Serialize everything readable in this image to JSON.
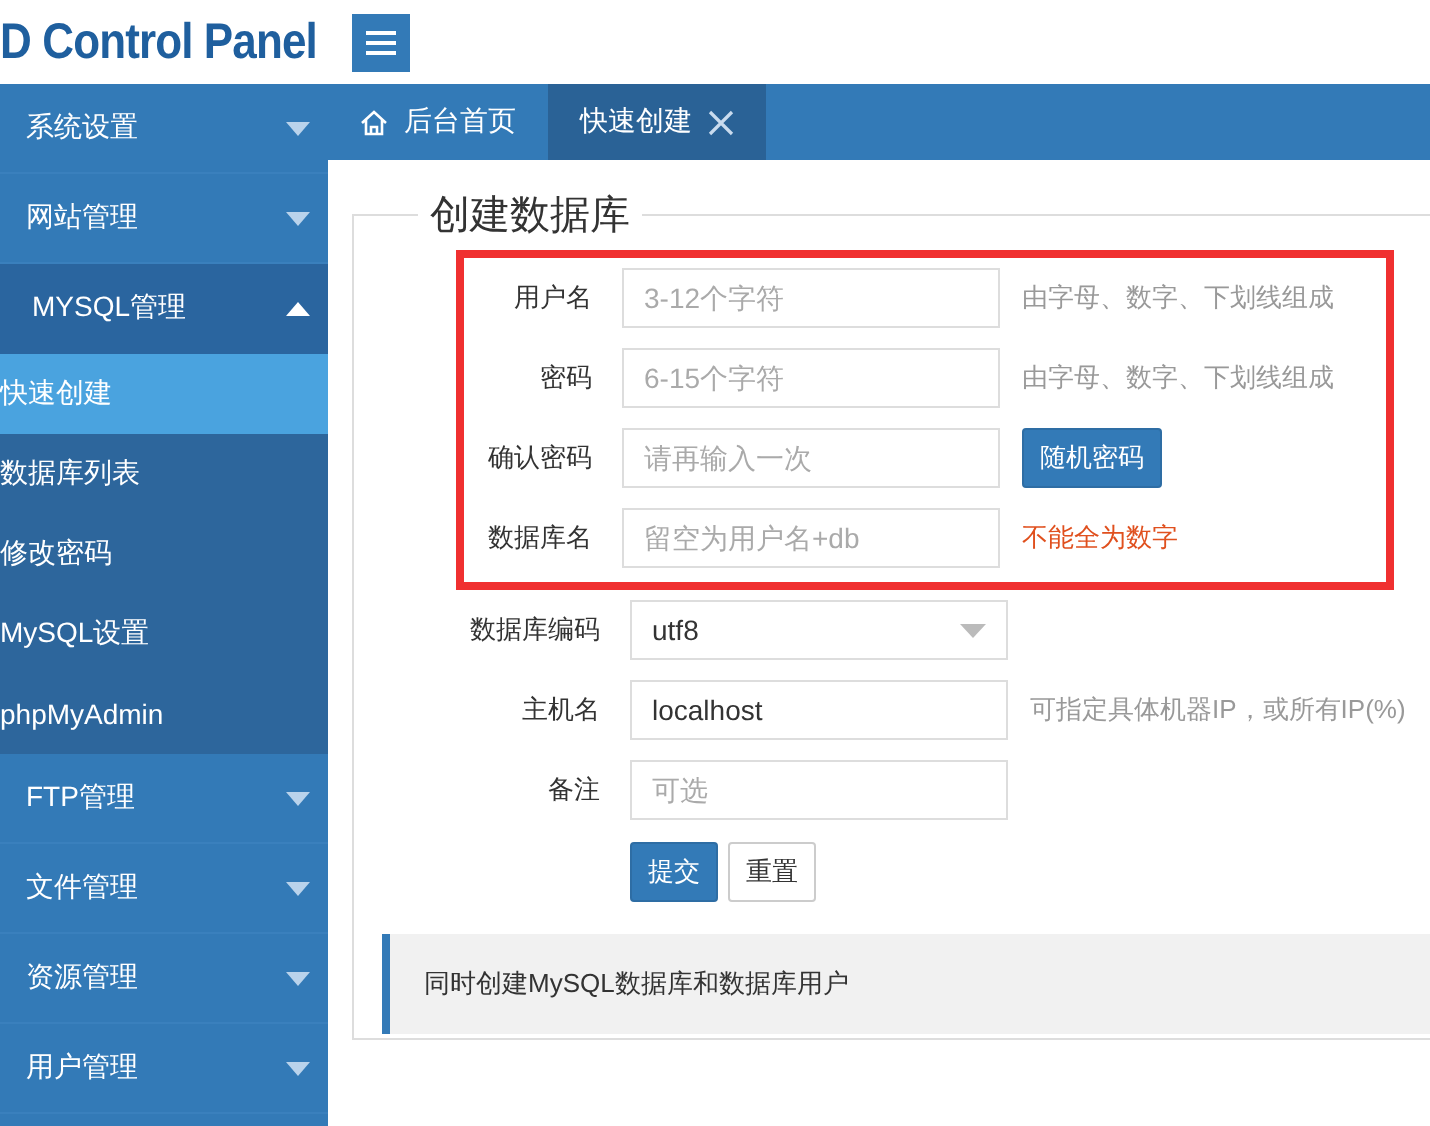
{
  "header": {
    "logo": "D Control Panel"
  },
  "sidebar": {
    "items": [
      {
        "label": "系统设置",
        "expanded": false
      },
      {
        "label": "网站管理",
        "expanded": false
      },
      {
        "label": "MYSQL管理",
        "expanded": true,
        "children": [
          {
            "label": "快速创建",
            "selected": true
          },
          {
            "label": "数据库列表",
            "selected": false
          },
          {
            "label": "修改密码",
            "selected": false
          },
          {
            "label": "MySQL设置",
            "selected": false
          },
          {
            "label": "phpMyAdmin",
            "selected": false
          }
        ]
      },
      {
        "label": "FTP管理",
        "expanded": false
      },
      {
        "label": "文件管理",
        "expanded": false
      },
      {
        "label": "资源管理",
        "expanded": false
      },
      {
        "label": "用户管理",
        "expanded": false
      }
    ]
  },
  "tabs": [
    {
      "label": "后台首页",
      "kind": "home",
      "selected": false
    },
    {
      "label": "快速创建",
      "kind": "closable",
      "selected": true
    }
  ],
  "form": {
    "legend": "创建数据库",
    "rows": [
      {
        "label": "用户名",
        "kind": "input",
        "placeholder": "3-12个字符",
        "hint": "由字母、数字、下划线组成",
        "highlighted": true
      },
      {
        "label": "密码",
        "kind": "input",
        "placeholder": "6-15个字符",
        "hint": "由字母、数字、下划线组成",
        "highlighted": true
      },
      {
        "label": "确认密码",
        "kind": "input",
        "placeholder": "请再输入一次",
        "button": "随机密码",
        "highlighted": true
      },
      {
        "label": "数据库名",
        "kind": "input",
        "placeholder": "留空为用户名+db",
        "error": "不能全为数字",
        "highlighted": true
      },
      {
        "label": "数据库编码",
        "kind": "select",
        "value": "utf8",
        "highlighted": false
      },
      {
        "label": "主机名",
        "kind": "input",
        "value": "localhost",
        "hint": "可指定具体机器IP，或所有IP(%)",
        "highlighted": false
      },
      {
        "label": "备注",
        "kind": "input",
        "placeholder": "可选",
        "highlighted": false
      }
    ],
    "buttons": [
      {
        "label": "提交",
        "primary": true
      },
      {
        "label": "重置",
        "primary": false
      }
    ],
    "note": "同时创建MySQL数据库和数据库用户"
  }
}
